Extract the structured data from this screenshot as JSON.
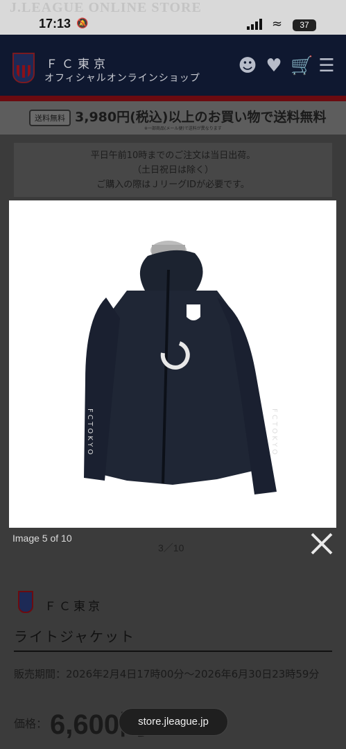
{
  "status_bar": {
    "watermark": "J.LEAGUE ONLINE STORE",
    "time": "17:13",
    "battery": "37"
  },
  "header": {
    "club_name": "ＦＣ東京",
    "shop_name": "オフィシャルオンラインショップ",
    "icons": [
      "account-icon",
      "favorite-heart-icon",
      "cart-icon",
      "menu-icon"
    ]
  },
  "shipping_banner": {
    "badge": "送料無料",
    "message": "3,980円(税込)以上のお買い物で送料無料",
    "note": "※一部商品(メール便)で送料が異なります"
  },
  "notice": {
    "line1": "平日午前10時までのご注文は当日出荷。",
    "line2": "（土日祝日は除く）",
    "line3": "ご購入の際はＪリーグIDが必要です。"
  },
  "gallery": {
    "caption": "Image 5 of 10",
    "counter": "3／10",
    "next_icon": "chevron-right-icon",
    "close_icon": "close-icon"
  },
  "product": {
    "club": "ＦＣ東京",
    "name": "ライトジャケット",
    "period": "販売期間：2026年2月4日17時00分～2026年6月30日23時59分",
    "price_label": "価格：",
    "price": "6,600円"
  },
  "url_bar": {
    "domain": "store.jleague.jp"
  },
  "colors": {
    "header_bg": "#0f1830",
    "accent_red": "#6b0b10",
    "overlay": "#3b3b3b"
  }
}
